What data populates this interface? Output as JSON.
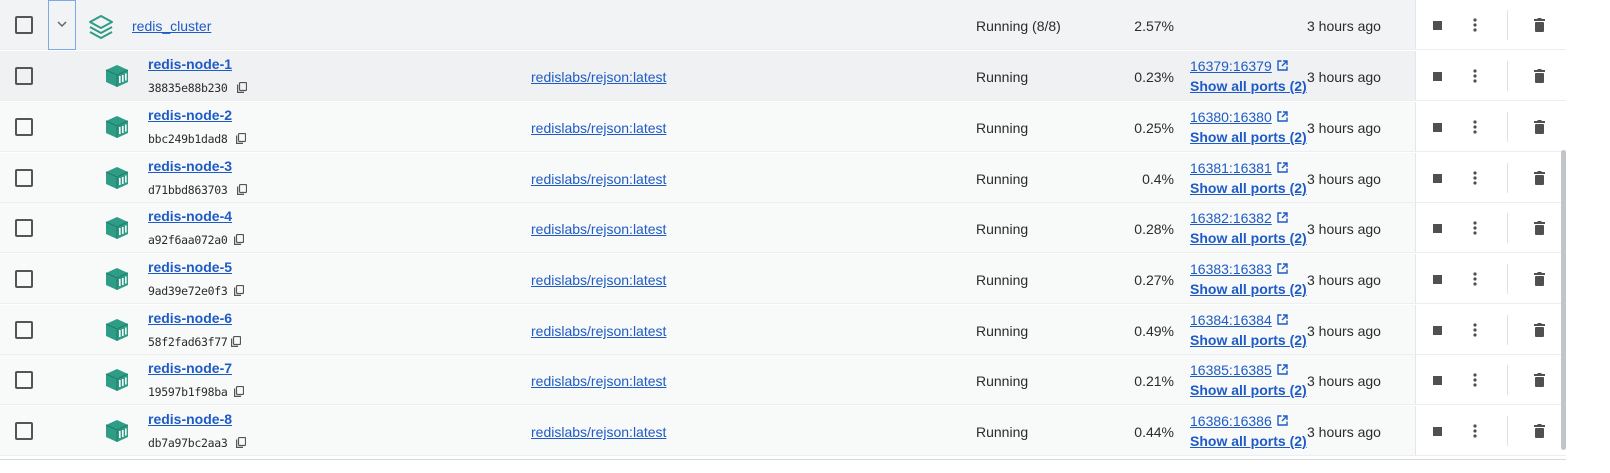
{
  "group": {
    "name": "redis_cluster",
    "status": "Running (8/8)",
    "cpu": "2.57%",
    "last_started": "3 hours ago"
  },
  "containers": [
    {
      "name": "redis-node-1",
      "id": "38835e88b230",
      "image": "redislabs/rejson:latest",
      "status": "Running",
      "cpu": "0.23%",
      "port": "16379:16379",
      "ports_link": "Show all ports (2)",
      "last_started": "3 hours ago"
    },
    {
      "name": "redis-node-2",
      "id": "bbc249b1dad8",
      "image": "redislabs/rejson:latest",
      "status": "Running",
      "cpu": "0.25%",
      "port": "16380:16380",
      "ports_link": "Show all ports (2)",
      "last_started": "3 hours ago"
    },
    {
      "name": "redis-node-3",
      "id": "d71bbd863703",
      "image": "redislabs/rejson:latest",
      "status": "Running",
      "cpu": "0.4%",
      "port": "16381:16381",
      "ports_link": "Show all ports (2)",
      "last_started": "3 hours ago"
    },
    {
      "name": "redis-node-4",
      "id": "a92f6aa072a0",
      "image": "redislabs/rejson:latest",
      "status": "Running",
      "cpu": "0.28%",
      "port": "16382:16382",
      "ports_link": "Show all ports (2)",
      "last_started": "3 hours ago"
    },
    {
      "name": "redis-node-5",
      "id": "9ad39e72e0f3",
      "image": "redislabs/rejson:latest",
      "status": "Running",
      "cpu": "0.27%",
      "port": "16383:16383",
      "ports_link": "Show all ports (2)",
      "last_started": "3 hours ago"
    },
    {
      "name": "redis-node-6",
      "id": "58f2fad63f77",
      "image": "redislabs/rejson:latest",
      "status": "Running",
      "cpu": "0.49%",
      "port": "16384:16384",
      "ports_link": "Show all ports (2)",
      "last_started": "3 hours ago"
    },
    {
      "name": "redis-node-7",
      "id": "19597b1f98ba",
      "image": "redislabs/rejson:latest",
      "status": "Running",
      "cpu": "0.21%",
      "port": "16385:16385",
      "ports_link": "Show all ports (2)",
      "last_started": "3 hours ago"
    },
    {
      "name": "redis-node-8",
      "id": "db7a97bc2aa3",
      "image": "redislabs/rejson:latest",
      "status": "Running",
      "cpu": "0.44%",
      "port": "16386:16386",
      "ports_link": "Show all ports (2)",
      "last_started": "3 hours ago"
    }
  ],
  "icons": {
    "group": "stack-icon",
    "container": "container-icon",
    "copy": "copy-icon",
    "external": "external-link-icon",
    "stop": "stop-icon",
    "more": "kebab-menu-icon",
    "delete": "trash-icon",
    "expand": "chevron-down-icon"
  },
  "colors": {
    "link": "#1e5bc6",
    "container_icon": "#2f9c86"
  }
}
